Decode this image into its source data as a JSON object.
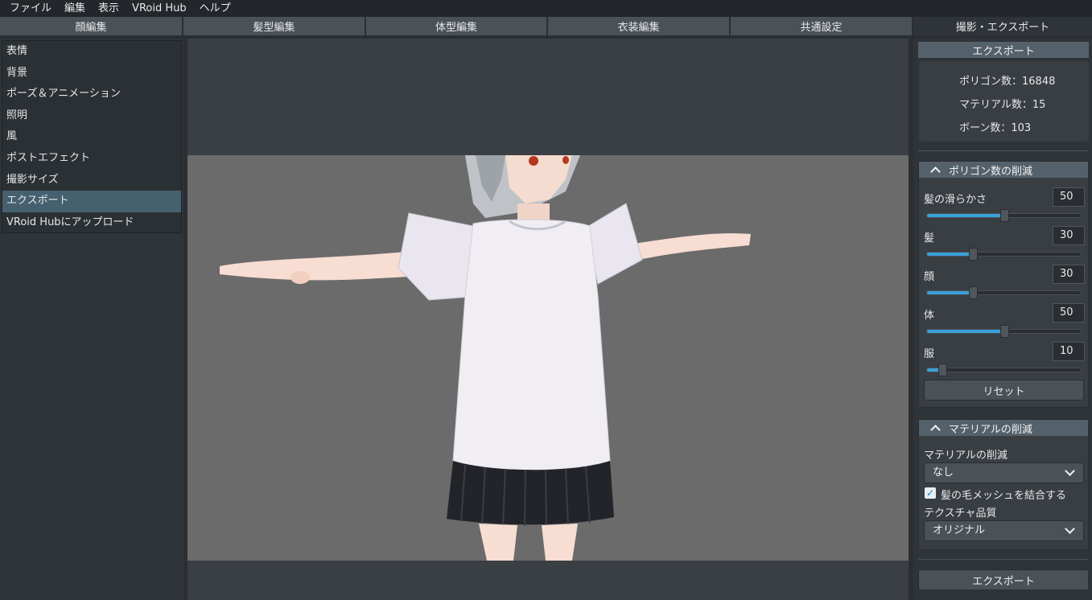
{
  "menu": [
    "ファイル",
    "編集",
    "表示",
    "VRoid Hub",
    "ヘルプ"
  ],
  "tabs": [
    "顔編集",
    "髪型編集",
    "体型編集",
    "衣装編集",
    "共通設定",
    "撮影・エクスポート"
  ],
  "left_menu": [
    "表情",
    "背景",
    "ポーズ＆アニメーション",
    "照明",
    "風",
    "ポストエフェクト",
    "撮影サイズ",
    "エクスポート",
    "VRoid Hubにアップロード"
  ],
  "left_active_index": 7,
  "export_panel": {
    "header": "エクスポート",
    "stats": {
      "polygons": "ポリゴン数：16848",
      "materials": "マテリアル数：15",
      "bones": "ボーン数：103"
    }
  },
  "polygon_reduction": {
    "header": "ポリゴン数の削減",
    "sliders": [
      {
        "label": "髪の滑らかさ",
        "value": "50",
        "fraction": 0.5
      },
      {
        "label": "髪",
        "value": "30",
        "fraction": 0.3
      },
      {
        "label": "顔",
        "value": "30",
        "fraction": 0.3
      },
      {
        "label": "体",
        "value": "50",
        "fraction": 0.5
      },
      {
        "label": "服",
        "value": "10",
        "fraction": 0.1
      }
    ],
    "reset_label": "リセット"
  },
  "material_reduction": {
    "header": "マテリアルの削減",
    "material_label": "マテリアルの削減",
    "material_value": "なし",
    "merge_hair_label": "髪の毛メッシュを結合する",
    "merge_hair_checked": "✓",
    "texture_label": "テクスチャ品質",
    "texture_value": "オリジナル"
  },
  "export_button": "エクスポート",
  "colors": {
    "accent": "#3aa0d8",
    "selected_item": "#45606f",
    "scene_bg": "#6b6b6b"
  }
}
